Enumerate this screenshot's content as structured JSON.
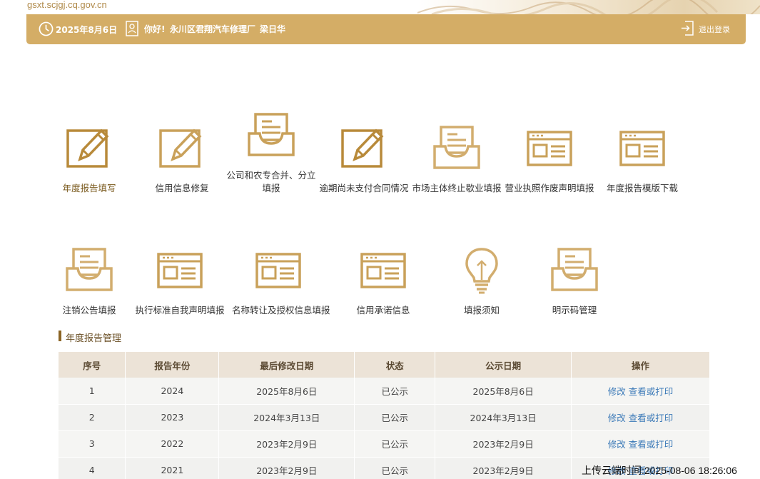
{
  "domain": "gsxt.scjgj.cq.gov.cn",
  "header": {
    "date": "2025年8月6日",
    "greeting": "你好!",
    "company": "永川区君翔汽车修理厂",
    "person": "梁日华",
    "logout": "退出登录",
    "bg_color": "#d4ad66"
  },
  "tiles": [
    {
      "label": "年度报告填写",
      "icon": "edit-icon"
    },
    {
      "label": "信用信息修复",
      "icon": "edit-icon"
    },
    {
      "label_line1": "公司和农专合并、分立",
      "label_line2": "填报",
      "icon": "inbox-icon"
    },
    {
      "label": "逾期尚未支付合同情况",
      "icon": "edit-icon"
    },
    {
      "label": "市场主体终止歇业填报",
      "icon": "inbox-icon"
    },
    {
      "label": "营业执照作废声明填报",
      "icon": "window-form-icon"
    },
    {
      "label": "年度报告模版下载",
      "icon": "window-form-icon"
    },
    {
      "label": "注销公告填报",
      "icon": "inbox-icon"
    },
    {
      "label": "执行标准自我声明填报",
      "icon": "window-form-icon"
    },
    {
      "label": "名称转让及授权信息填报",
      "icon": "window-form-icon"
    },
    {
      "label": "信用承诺信息",
      "icon": "window-form-icon"
    },
    {
      "label": "填报须知",
      "icon": "lightbulb-icon"
    },
    {
      "label": "明示码管理",
      "icon": "inbox-icon"
    }
  ],
  "section_title": "年度报告管理",
  "table": {
    "headers": [
      "序号",
      "报告年份",
      "最后修改日期",
      "状态",
      "公示日期",
      "操作"
    ],
    "rows": [
      {
        "no": "1",
        "year": "2024",
        "modified": "2025年8月6日",
        "status": "已公示",
        "published": "2025年8月6日",
        "edit": "修改",
        "view": "查看或打印"
      },
      {
        "no": "2",
        "year": "2023",
        "modified": "2024年3月13日",
        "status": "已公示",
        "published": "2024年3月13日",
        "edit": "修改",
        "view": "查看或打印"
      },
      {
        "no": "3",
        "year": "2022",
        "modified": "2023年2月9日",
        "status": "已公示",
        "published": "2023年2月9日",
        "edit": "修改",
        "view": "查看或打印"
      },
      {
        "no": "4",
        "year": "2021",
        "modified": "2023年2月9日",
        "status": "已公示",
        "published": "2023年2月9日",
        "edit": "修改",
        "view": "查看或打印"
      }
    ]
  },
  "upload_time": "上传云端时间:2025-08-06 18:26:06",
  "colors": {
    "accent": "#c9a15a",
    "link": "#3c7ab8"
  }
}
